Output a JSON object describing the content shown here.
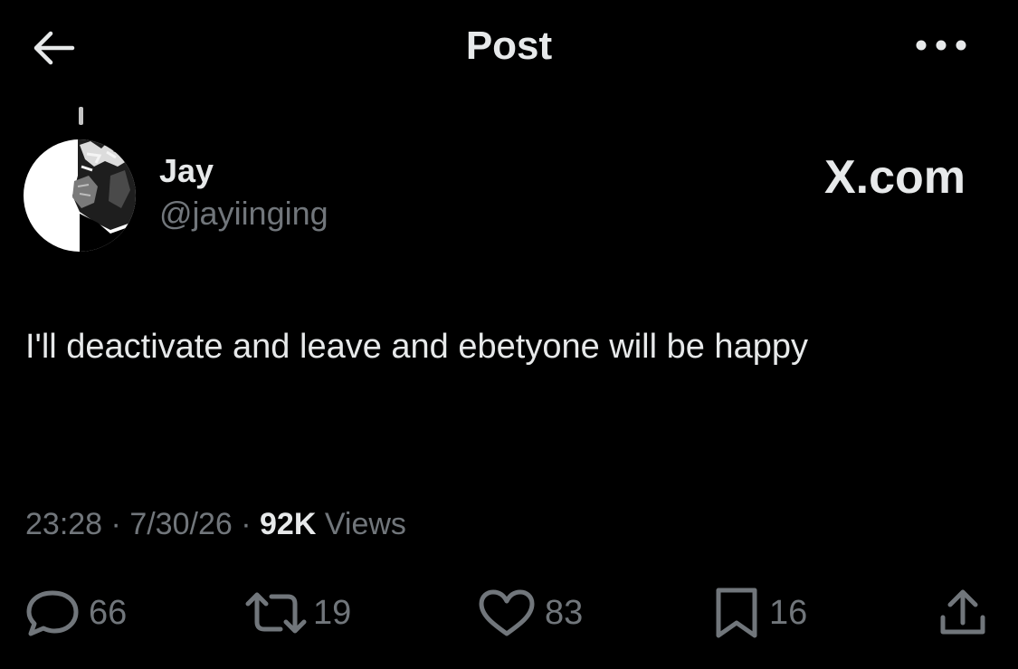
{
  "header": {
    "title": "Post",
    "back_icon": "arrow-left-icon",
    "more_icon": "more-horizontal-icon"
  },
  "post": {
    "author": {
      "name": "Jay",
      "handle": "@jayiinging",
      "avatar": "avatar-image"
    },
    "brand_label": "X.com",
    "text": "I'll deactivate and leave and ebetyone will be happy",
    "time": "23:28",
    "date": "7/30/26",
    "separator": "·",
    "views_count": "92K",
    "views_label": "Views"
  },
  "actions": {
    "replies": {
      "count": "66",
      "icon": "reply-icon"
    },
    "reposts": {
      "count": "19",
      "icon": "repost-icon"
    },
    "likes": {
      "count": "83",
      "icon": "heart-icon"
    },
    "bookmarks": {
      "count": "16",
      "icon": "bookmark-icon"
    },
    "share": {
      "icon": "share-icon"
    }
  },
  "colors": {
    "background": "#000000",
    "primary_text": "#e7e9ea",
    "secondary_text": "#71767b"
  }
}
